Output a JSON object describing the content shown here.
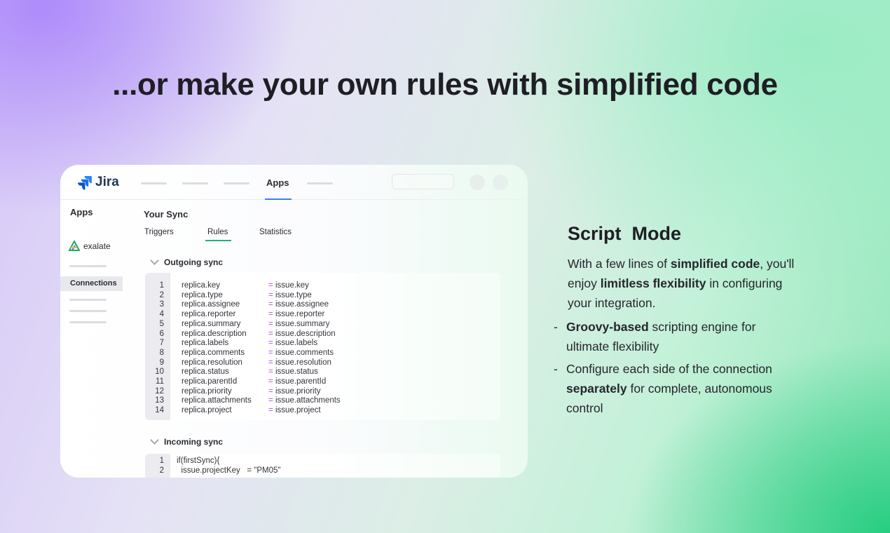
{
  "headline": "...or make your own rules with simplified code",
  "app": {
    "logo_text": "Jira",
    "nav_active": "Apps",
    "sidebar_title": "Apps",
    "sidebar_app": "exalate",
    "sidebar_connections": "Connections",
    "sync_title": "Your Sync",
    "tabs": [
      "Triggers",
      "Rules",
      "Statistics"
    ],
    "active_tab": "Rules",
    "outgoing_title": "Outgoing sync",
    "incoming_title": "Incoming sync",
    "outgoing_code": [
      {
        "n": "1",
        "lhs": "replica.key",
        "rhs": "issue.key"
      },
      {
        "n": "2",
        "lhs": "replica.type",
        "rhs": "issue.type"
      },
      {
        "n": "3",
        "lhs": "replica.assignee",
        "rhs": "issue.assignee"
      },
      {
        "n": "4",
        "lhs": "replica.reporter",
        "rhs": "issue.reporter"
      },
      {
        "n": "5",
        "lhs": "replica.summary",
        "rhs": "issue.summary"
      },
      {
        "n": "6",
        "lhs": "replica.description",
        "rhs": "issue.description"
      },
      {
        "n": "7",
        "lhs": "replica.labels",
        "rhs": "issue.labels"
      },
      {
        "n": "8",
        "lhs": "replica.comments",
        "rhs": "issue.comments"
      },
      {
        "n": "9",
        "lhs": "replica.resolution",
        "rhs": "issue.resolution"
      },
      {
        "n": "10",
        "lhs": "replica.status",
        "rhs": "issue.status"
      },
      {
        "n": "11",
        "lhs": "replica.parentId",
        "rhs": "issue.parentId"
      },
      {
        "n": "12",
        "lhs": "replica.priority",
        "rhs": "issue.priority"
      },
      {
        "n": "13",
        "lhs": "replica.attachments",
        "rhs": "issue.attachments"
      },
      {
        "n": "14",
        "lhs": "replica.project",
        "rhs": "issue.project"
      }
    ],
    "incoming_code": [
      {
        "n": "1",
        "text": "if(firstSync){"
      },
      {
        "n": "2",
        "text": "  issue.projectKey   = \"PM05\""
      }
    ]
  },
  "script_mode": {
    "title": "Script  Mode",
    "desc_parts": [
      "With a few lines of ",
      "simplified code",
      ",  you'll enjoy ",
      "limitless flexibility",
      " in configuring your integration."
    ],
    "bullets": [
      {
        "bold": "Groovy-based",
        "text": " scripting engine for ultimate flexibility"
      },
      {
        "prefix": "Configure each side of the connection ",
        "bold": "separately",
        "text": " for complete, autonomous control"
      }
    ]
  },
  "colors": {
    "accent_tab": "#22b07d",
    "accent_nav": "#3f7ee8",
    "operator": "#b54fd6"
  }
}
